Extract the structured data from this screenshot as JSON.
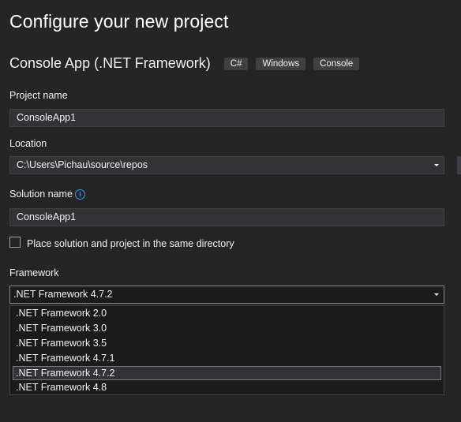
{
  "page": {
    "title": "Configure your new project"
  },
  "template": {
    "name": "Console App (.NET Framework)",
    "tags": [
      "C#",
      "Windows",
      "Console"
    ]
  },
  "project_name": {
    "label": "Project name",
    "value": "ConsoleApp1"
  },
  "location": {
    "label": "Location",
    "value": "C:\\Users\\Pichau\\source\\repos"
  },
  "solution_name": {
    "label": "Solution name",
    "info_icon": "info-icon",
    "value": "ConsoleApp1"
  },
  "same_directory": {
    "label": "Place solution and project in the same directory",
    "checked": false
  },
  "framework": {
    "label": "Framework",
    "selected": ".NET Framework 4.7.2",
    "options": [
      ".NET Framework 2.0",
      ".NET Framework 3.0",
      ".NET Framework 3.5",
      ".NET Framework 4.7.1",
      ".NET Framework 4.7.2",
      ".NET Framework 4.8"
    ]
  },
  "colors": {
    "background": "#252526",
    "input_background": "#333337",
    "accent": "#3794ff"
  }
}
